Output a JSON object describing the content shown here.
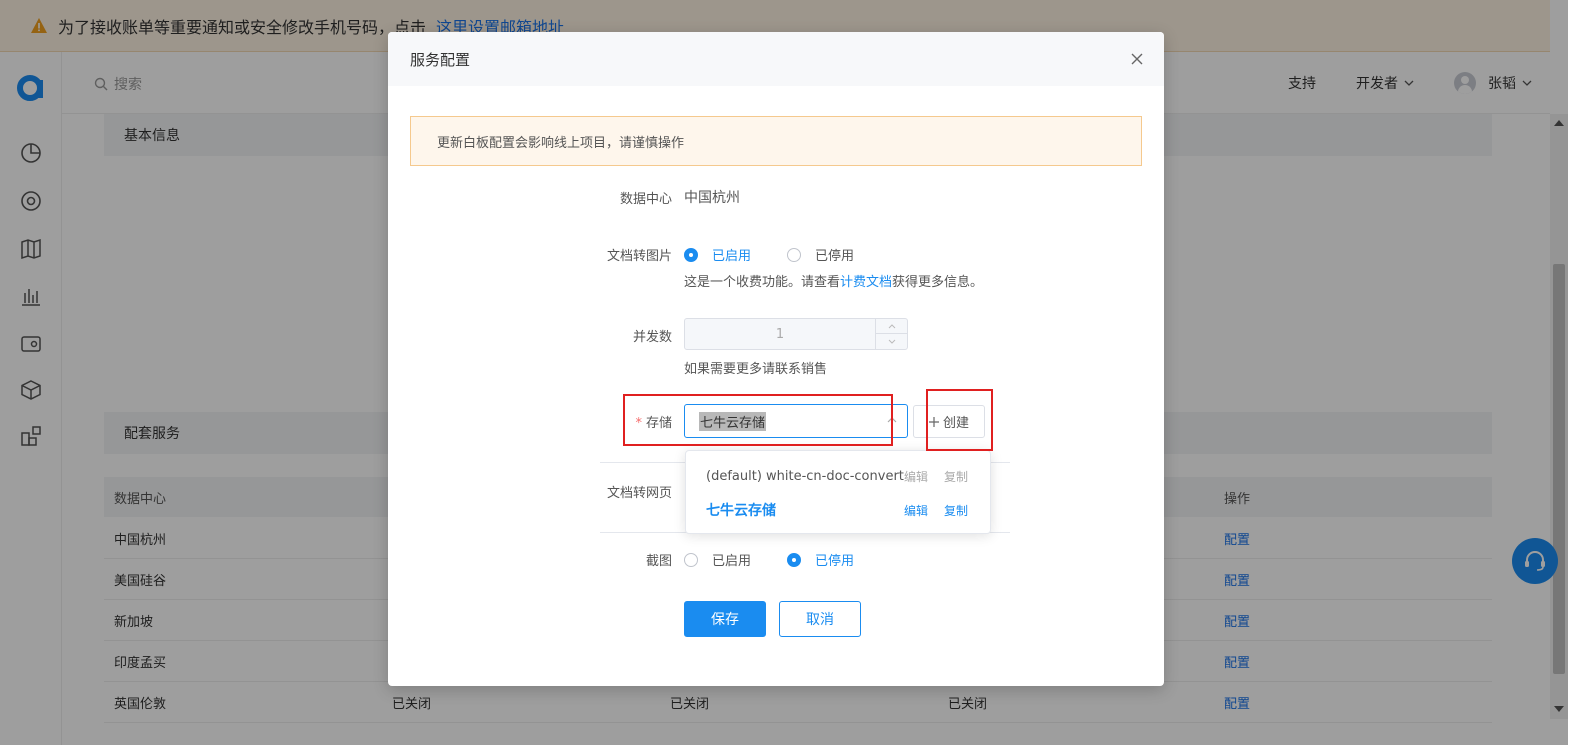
{
  "banner": {
    "text": "为了接收账单等重要通知或安全修改手机号码，点击",
    "link": "这里设置邮箱地址"
  },
  "topbar": {
    "search_placeholder": "搜索",
    "support": "支持",
    "developer": "开发者",
    "username": "张韬"
  },
  "content": {
    "basic_info": "基本信息",
    "services": "配套服务",
    "table": {
      "headers": [
        "数据中心",
        "",
        "",
        "",
        "操作"
      ],
      "rows": [
        {
          "dc": "中国杭州",
          "c2": "",
          "c3": "",
          "c4": "",
          "action": "配置"
        },
        {
          "dc": "美国硅谷",
          "c2": "",
          "c3": "",
          "c4": "",
          "action": "配置"
        },
        {
          "dc": "新加坡",
          "c2": "",
          "c3": "",
          "c4": "",
          "action": "配置"
        },
        {
          "dc": "印度孟买",
          "c2": "",
          "c3": "",
          "c4": "",
          "action": "配置"
        },
        {
          "dc": "英国伦敦",
          "c2": "已关闭",
          "c3": "已关闭",
          "c4": "已关闭",
          "action": "配置"
        }
      ]
    }
  },
  "modal": {
    "title": "服务配置",
    "alert": "更新白板配置会影响线上项目，请谨慎操作",
    "datacenter_label": "数据中心",
    "datacenter_value": "中国杭州",
    "doc_to_image_label": "文档转图片",
    "enabled": "已启用",
    "disabled": "已停用",
    "hint_pre": "这是一个收费功能。请查看",
    "hint_link": "计费文档",
    "hint_post": "获得更多信息。",
    "concurrency_label": "并发数",
    "concurrency_value": "1",
    "concurrency_hint": "如果需要更多请联系销售",
    "storage_label": "存储",
    "storage_value": "七牛云存储",
    "create_label": "创建",
    "doc_to_web_label": "文档转网页",
    "screenshot_label": "截图",
    "save": "保存",
    "cancel": "取消",
    "dropdown": [
      {
        "name": "(default) white-cn-doc-convert",
        "edit": "编辑",
        "copy": "复制",
        "selected": false
      },
      {
        "name": "七牛云存储",
        "edit": "编辑",
        "copy": "复制",
        "selected": true
      }
    ]
  },
  "colors": {
    "accent": "#1a8cf0",
    "annotation": "#e02020",
    "alert_bg": "#fef6ec"
  }
}
